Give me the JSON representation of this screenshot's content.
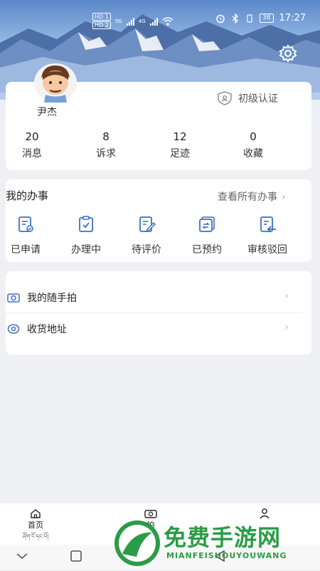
{
  "status_bar": {
    "hd1": "HD 1",
    "hd2": "HD 2",
    "net1": "5G",
    "net2": "4G",
    "battery": "38",
    "time": "17:27"
  },
  "profile": {
    "username": "尹杰",
    "verify_label": "初级认证"
  },
  "stats": [
    {
      "value": "20",
      "label": "消息"
    },
    {
      "value": "8",
      "label": "诉求"
    },
    {
      "value": "12",
      "label": "足迹"
    },
    {
      "value": "0",
      "label": "收藏"
    }
  ],
  "affairs": {
    "title": "我的办事",
    "view_all": "查看所有办事",
    "actions": [
      {
        "label": "已申请",
        "icon": "applied-icon"
      },
      {
        "label": "办理中",
        "icon": "processing-icon"
      },
      {
        "label": "待评价",
        "icon": "to-review-icon"
      },
      {
        "label": "已预约",
        "icon": "booked-icon"
      },
      {
        "label": "审核驳回",
        "icon": "rejected-icon"
      }
    ]
  },
  "list": [
    {
      "label": "我的随手拍",
      "icon": "camera-icon"
    },
    {
      "label": "收货地址",
      "icon": "location-icon"
    }
  ],
  "bottom_nav": [
    {
      "label": "首页",
      "sub": "ཤོག་ངོ་དང་པོ།",
      "icon": "home-icon"
    },
    {
      "label": "拍",
      "icon": "camera-icon"
    },
    {
      "label": "",
      "icon": "person-icon"
    }
  ],
  "watermark": {
    "title": "免费手游网",
    "subtitle": "MIANFEISHOUYOUWANG"
  },
  "colors": {
    "accent": "#2f6fd6",
    "icon_blue": "#3b6fc4",
    "watermark_green": "#2a9c47"
  }
}
